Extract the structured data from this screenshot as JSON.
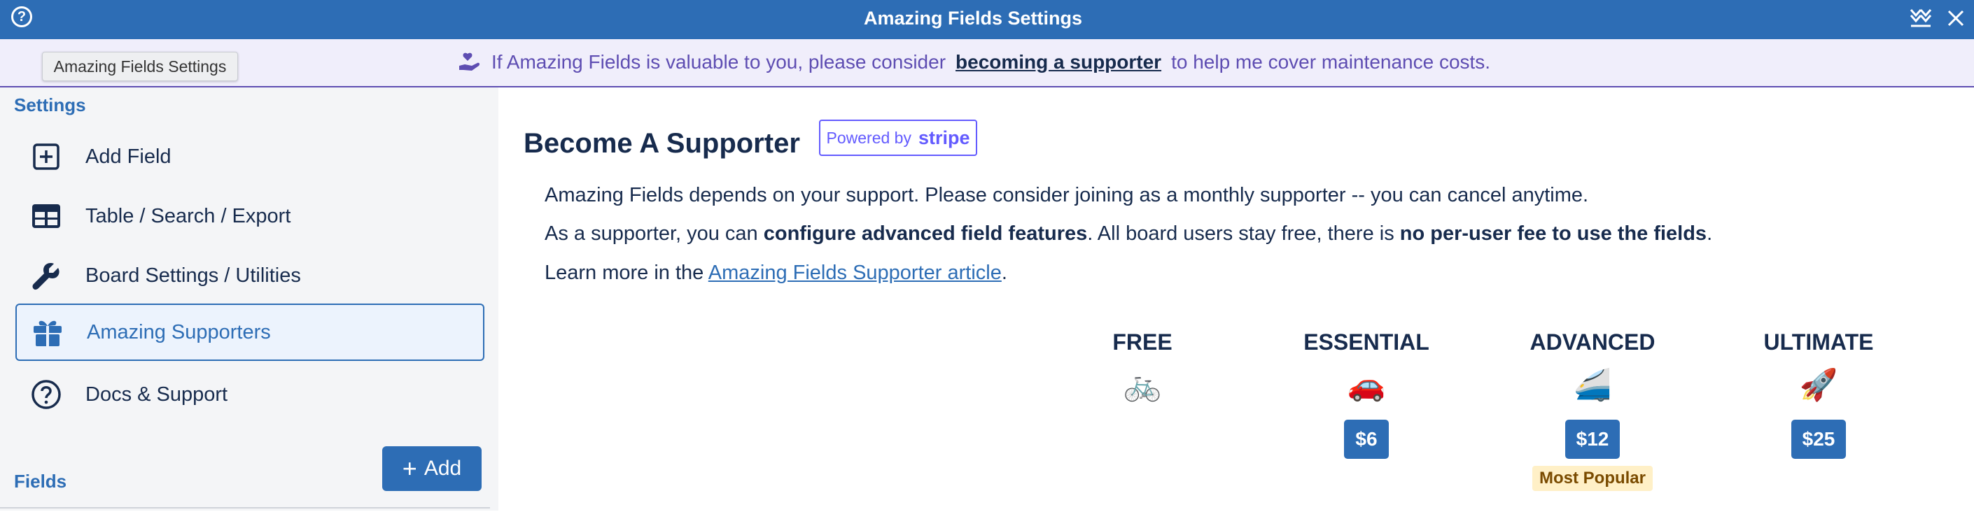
{
  "window": {
    "title": "Amazing Fields Settings"
  },
  "banner": {
    "prefix": "If Amazing Fields is valuable to you, please consider",
    "link": "becoming a supporter",
    "suffix": "to help me cover maintenance costs."
  },
  "tooltip": {
    "text": "Amazing Fields Settings"
  },
  "sidebar": {
    "settings_label": "Settings",
    "items": [
      {
        "label": "Add Field",
        "icon": "add-box-icon"
      },
      {
        "label": "Table / Search / Export",
        "icon": "table-icon"
      },
      {
        "label": "Board Settings / Utilities",
        "icon": "wrench-icon"
      },
      {
        "label": "Amazing Supporters",
        "icon": "gift-icon",
        "active": true
      },
      {
        "label": "Docs & Support",
        "icon": "question-icon"
      }
    ],
    "fields_label": "Fields",
    "add_button": "Add"
  },
  "main": {
    "heading": "Become A Supporter",
    "stripe": {
      "powered": "Powered by",
      "brand": "stripe"
    },
    "p1": "Amazing Fields depends on your support. Please consider joining as a monthly supporter -- you can cancel anytime.",
    "p2": {
      "a": "As a supporter, you can ",
      "b": "configure advanced field features",
      "c": ". All board users stay free, there is ",
      "d": "no per-user fee to use the fields",
      "e": "."
    },
    "p3": {
      "prefix": "Learn more in the ",
      "link": "Amazing Fields Supporter article",
      "suffix": "."
    },
    "tiers": [
      {
        "name": "FREE",
        "emoji": "🚲",
        "price": ""
      },
      {
        "name": "ESSENTIAL",
        "emoji": "🚗",
        "price": "$6"
      },
      {
        "name": "ADVANCED",
        "emoji": "🚄",
        "price": "$12",
        "badge": "Most Popular"
      },
      {
        "name": "ULTIMATE",
        "emoji": "🚀",
        "price": "$25"
      }
    ]
  },
  "colors": {
    "primary": "#2d6db5",
    "banner_bg": "#f0eefb",
    "banner_text": "#5e4db2",
    "stripe": "#635bff",
    "sidebar_bg": "#f4f5f7"
  }
}
